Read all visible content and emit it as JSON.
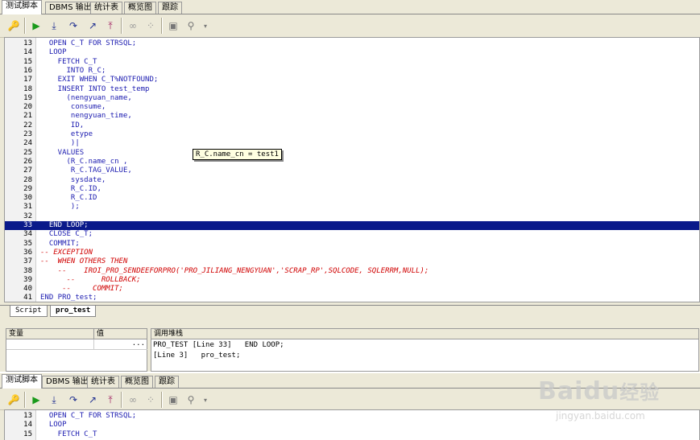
{
  "tabs": [
    "测试脚本",
    "DBMS 输出",
    "统计表",
    "概览图",
    "跟踪"
  ],
  "code_lines": [
    {
      "n": "13",
      "t": "  OPEN C_T FOR STRSQL;",
      "style": "kw"
    },
    {
      "n": "14",
      "t": "  LOOP",
      "style": "kw"
    },
    {
      "n": "15",
      "t": "    FETCH C_T",
      "style": "kw"
    },
    {
      "n": "16",
      "t": "      INTO R_C;",
      "style": "kw"
    },
    {
      "n": "17",
      "t": "    EXIT WHEN C_T%NOTFOUND;",
      "style": "kw"
    },
    {
      "n": "18",
      "t": "    INSERT INTO test_temp",
      "style": "kw"
    },
    {
      "n": "19",
      "t": "      (nengyuan_name,",
      "style": "kw"
    },
    {
      "n": "20",
      "t": "       consume,",
      "style": "kw"
    },
    {
      "n": "21",
      "t": "       nengyuan_time,",
      "style": "kw"
    },
    {
      "n": "22",
      "t": "       ID,",
      "style": "kw"
    },
    {
      "n": "23",
      "t": "       etype",
      "style": "kw"
    },
    {
      "n": "24",
      "t": "       )|",
      "style": "kw"
    },
    {
      "n": "25",
      "t": "    VALUES",
      "style": "kw"
    },
    {
      "n": "26",
      "t": "      (R_C.name_cn ,",
      "style": "kw"
    },
    {
      "n": "27",
      "t": "       R_C.TAG_VALUE,",
      "style": "kw"
    },
    {
      "n": "28",
      "t": "       sysdate,",
      "style": "kw"
    },
    {
      "n": "29",
      "t": "       R_C.ID,",
      "style": "kw"
    },
    {
      "n": "30",
      "t": "       R_C.ID",
      "style": "kw"
    },
    {
      "n": "31",
      "t": "       );",
      "style": "kw"
    },
    {
      "n": "32",
      "t": "",
      "style": "kw"
    },
    {
      "n": "33",
      "t": "  END LOOP;",
      "style": "hl"
    },
    {
      "n": "34",
      "t": "  CLOSE C_T;",
      "style": "kw"
    },
    {
      "n": "35",
      "t": "  COMMIT;",
      "style": "kw"
    },
    {
      "n": "36",
      "t": "-- EXCEPTION",
      "style": "cm"
    },
    {
      "n": "37",
      "t": "--  WHEN OTHERS THEN",
      "style": "cm"
    },
    {
      "n": "38",
      "t": "    --    IROI_PRO_SENDEEFORPRO('PRO_JILIANG_NENGYUAN','SCRAP_RP',SQLCODE, SQLERRM,NULL);",
      "style": "cm"
    },
    {
      "n": "39",
      "t": "      --      ROLLBACK;",
      "style": "cm"
    },
    {
      "n": "40",
      "t": "     --     COMMIT;",
      "style": "cm"
    },
    {
      "n": "41",
      "t": "END PRO_test;",
      "style": "kw"
    }
  ],
  "tooltip": "R_C.name_cn = test1",
  "bottom_tabs": [
    "Script",
    "pro_test"
  ],
  "var_panel": {
    "col1": "变量",
    "col2": "值",
    "ellipsis": "..."
  },
  "stack_panel": {
    "title": "调用堆栈",
    "rows": [
      "PRO_TEST [Line 33]   END LOOP;",
      "[Line 3]   pro_test;"
    ]
  },
  "tabs2": [
    "测试脚本",
    "DBMS 输出",
    "统计表",
    "概览图",
    "跟踪"
  ],
  "code_lines2": [
    {
      "n": "13",
      "t": "  OPEN C_T FOR STRSQL;"
    },
    {
      "n": "14",
      "t": "  LOOP"
    },
    {
      "n": "15",
      "t": "    FETCH C_T"
    }
  ],
  "watermark": {
    "brand": "Baidu",
    "cn": "经验",
    "url": "jingyan.baidu.com"
  }
}
